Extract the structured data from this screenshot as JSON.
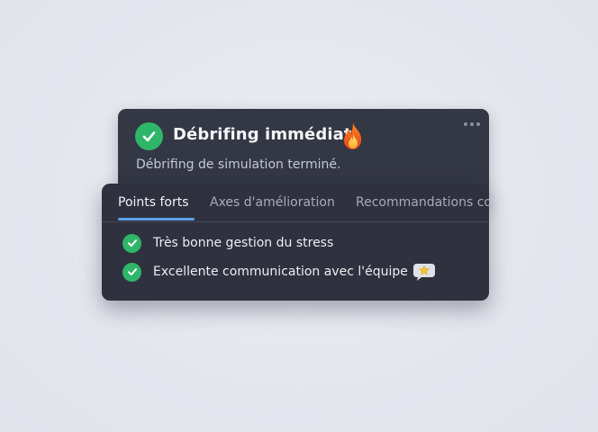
{
  "header_card": {
    "title": "Débrifing immédiat",
    "subtitle": "Débrifing de simulation terminé.",
    "icons": {
      "status": "check-circle-icon",
      "decoration": "fire-icon",
      "menu": "more-horizontal-icon"
    }
  },
  "tabs": [
    {
      "label": "Points forts",
      "active": true
    },
    {
      "label": "Axes d'amélioration",
      "active": false
    },
    {
      "label": "Recommandations co",
      "active": false
    }
  ],
  "strengths": [
    {
      "text": "Très bonne gestion du stress",
      "icon": "check-circle-icon"
    },
    {
      "text": "Excellente communication avec l'équipe",
      "icon": "check-circle-icon",
      "trailing_icon": "star-speech-bubble-icon"
    }
  ],
  "colors": {
    "accent_green": "#2fb66a",
    "tab_underline": "#5e9fe6",
    "card_background": "#343744"
  }
}
